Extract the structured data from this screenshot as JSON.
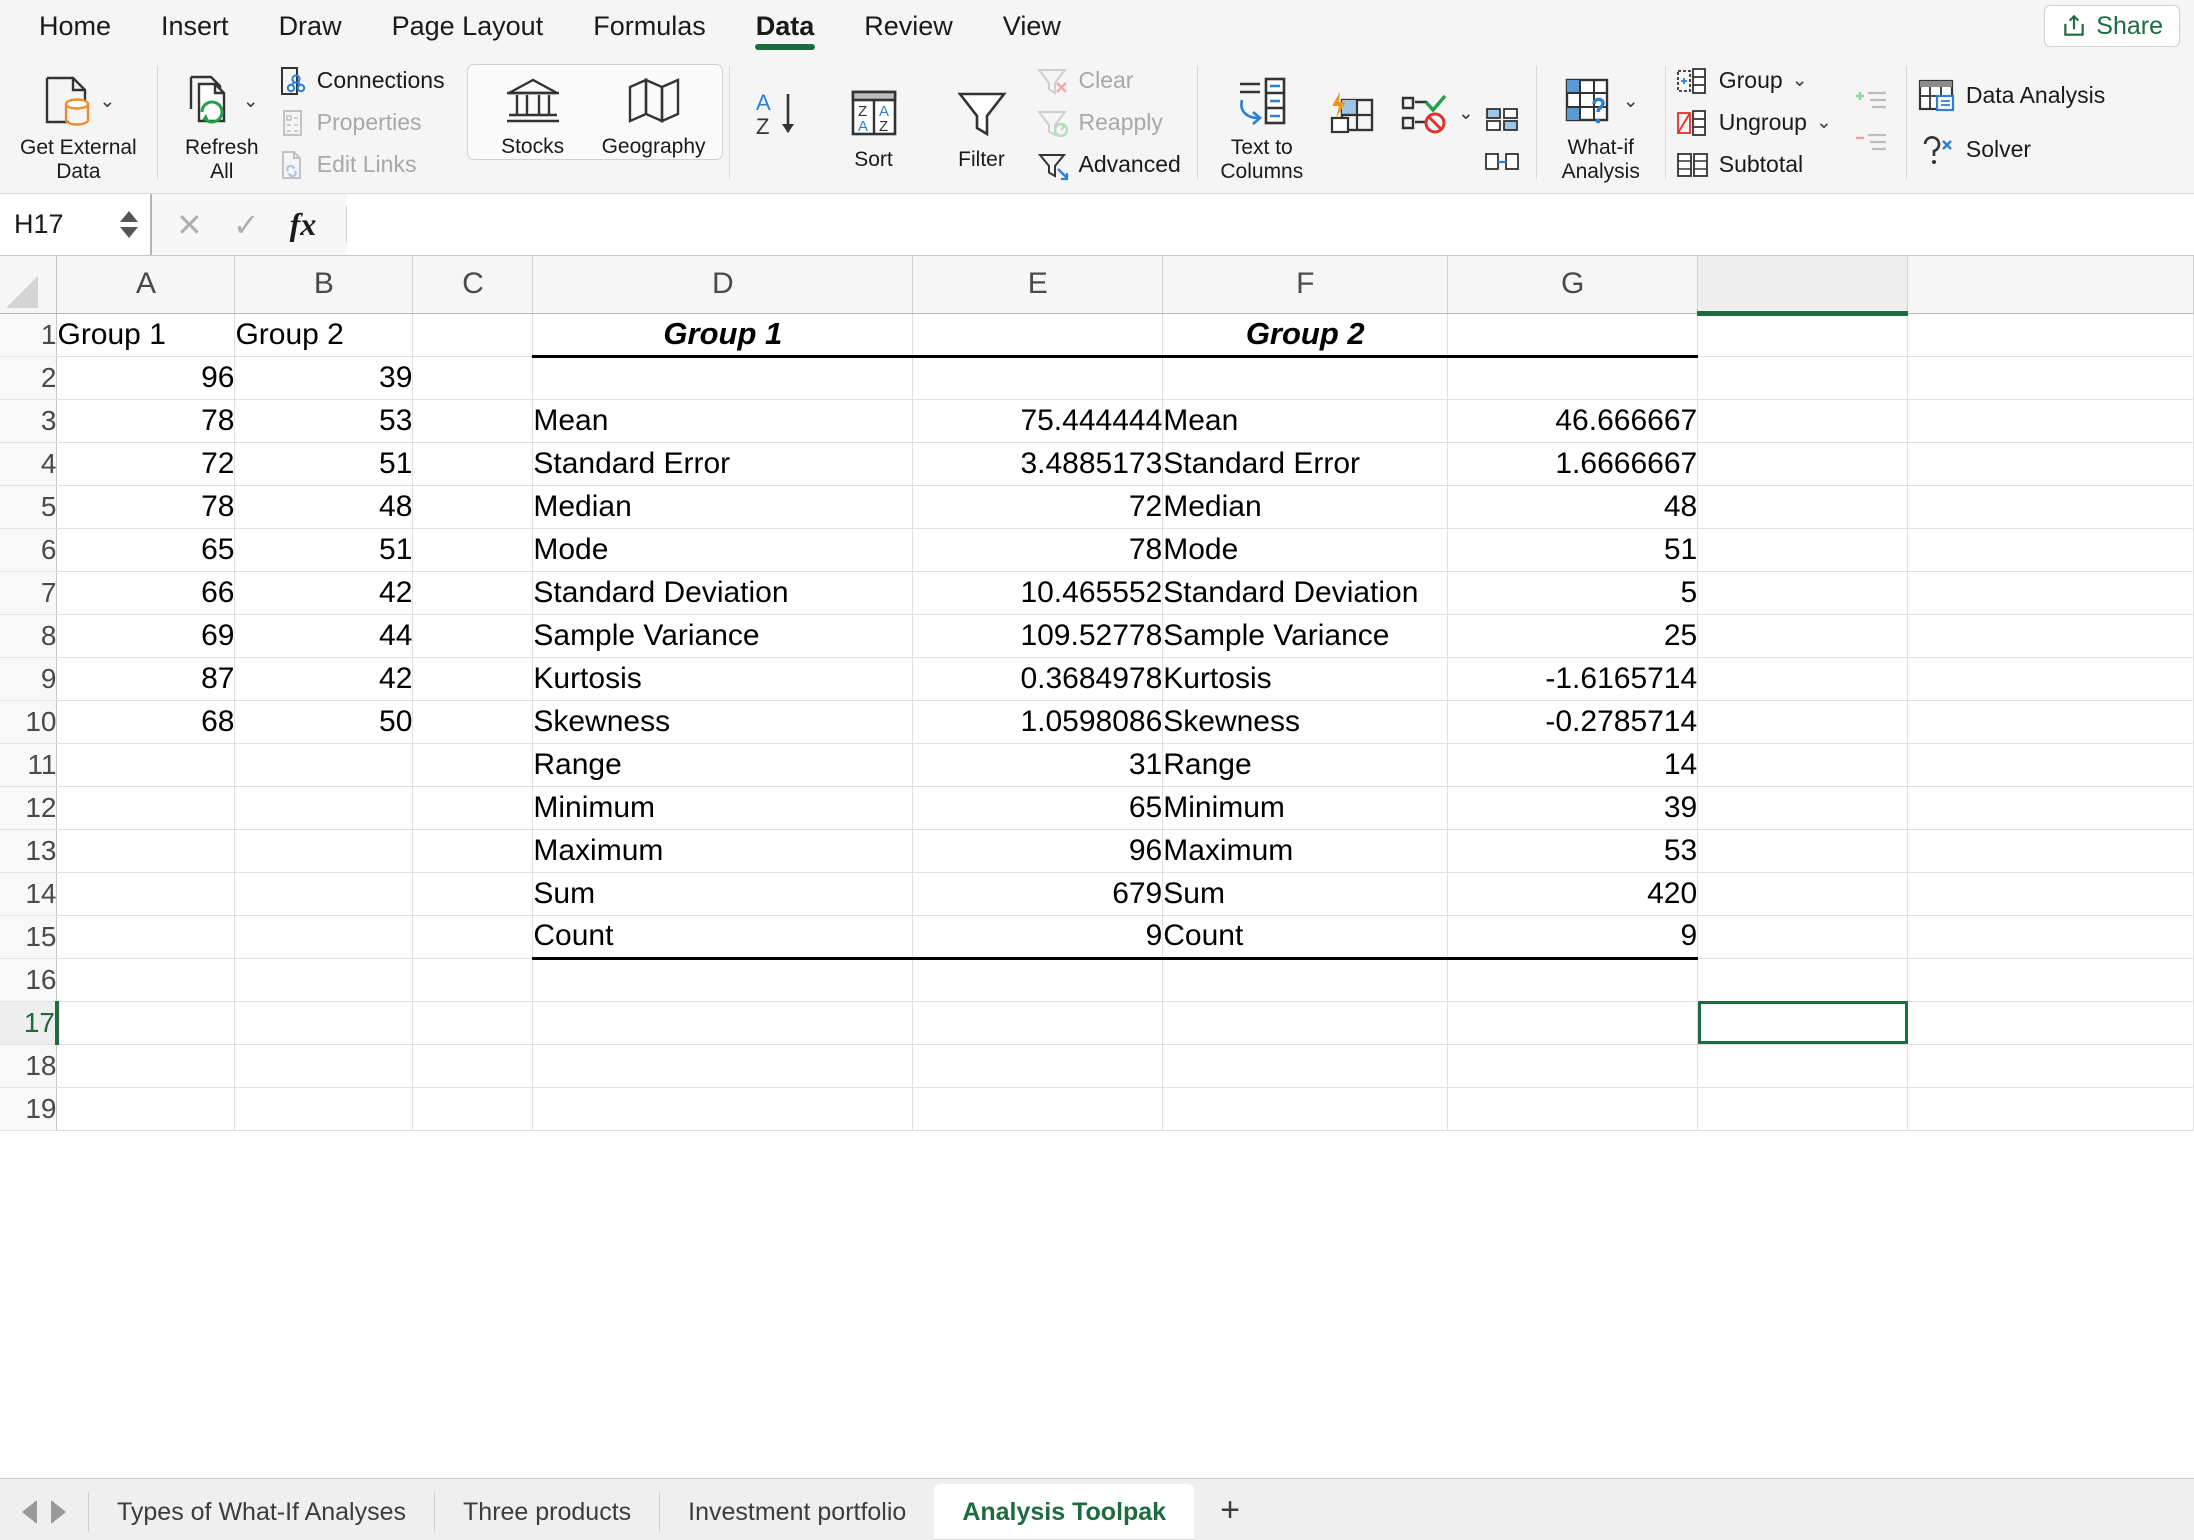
{
  "ribbon_tabs": [
    {
      "label": "Home",
      "active": false
    },
    {
      "label": "Insert",
      "active": false
    },
    {
      "label": "Draw",
      "active": false
    },
    {
      "label": "Page Layout",
      "active": false
    },
    {
      "label": "Formulas",
      "active": false
    },
    {
      "label": "Data",
      "active": true
    },
    {
      "label": "Review",
      "active": false
    },
    {
      "label": "View",
      "active": false
    }
  ],
  "share": {
    "label": "Share",
    "icon": "share-export-icon",
    "color": "#1e6b3f"
  },
  "ribbon": {
    "get_external_data": {
      "label": "Get External\nData",
      "line1": "Get External",
      "line2": "Data",
      "icon": "database-document-icon"
    },
    "refresh_all": {
      "label": "Refresh All",
      "line1": "Refresh",
      "line2": "All",
      "icon": "refresh-documents-icon"
    },
    "connections": {
      "label": "Connections",
      "icon": "connections-icon",
      "disabled": false
    },
    "properties": {
      "label": "Properties",
      "icon": "properties-icon",
      "disabled": true
    },
    "edit_links": {
      "label": "Edit Links",
      "icon": "edit-links-icon",
      "disabled": true
    },
    "stocks": {
      "label": "Stocks",
      "icon": "bank-building-icon"
    },
    "geography": {
      "label": "Geography",
      "icon": "map-icon"
    },
    "sort_az": {
      "label": "",
      "icon": "sort-a-to-z-icon"
    },
    "sort": {
      "label": "Sort",
      "icon": "sort-dialog-icon"
    },
    "filter": {
      "label": "Filter",
      "icon": "funnel-icon"
    },
    "clear": {
      "label": "Clear",
      "icon": "clear-filter-icon",
      "disabled": true
    },
    "reapply": {
      "label": "Reapply",
      "icon": "reapply-filter-icon",
      "disabled": true
    },
    "advanced": {
      "label": "Advanced",
      "icon": "advanced-filter-icon",
      "disabled": false
    },
    "text_to_columns": {
      "label": "Text to Columns",
      "line1": "Text to",
      "line2": "Columns",
      "icon": "text-to-columns-icon"
    },
    "flash_fill": {
      "label": "",
      "icon": "flash-fill-icon"
    },
    "data_validation": {
      "label": "",
      "icon": "data-validation-icon"
    },
    "consolidate": {
      "label": "",
      "icon": "consolidate-icon"
    },
    "relationships": {
      "label": "",
      "icon": "relationships-icon"
    },
    "what_if": {
      "label": "What-if Analysis",
      "line1": "What-if",
      "line2": "Analysis",
      "icon": "what-if-grid-icon"
    },
    "group": {
      "label": "Group",
      "icon": "group-icon"
    },
    "ungroup": {
      "label": "Ungroup",
      "icon": "ungroup-icon"
    },
    "subtotal": {
      "label": "Subtotal",
      "icon": "subtotal-icon"
    },
    "show_detail": {
      "label": "",
      "icon": "show-detail-icon"
    },
    "hide_detail": {
      "label": "",
      "icon": "hide-detail-icon"
    },
    "data_analysis": {
      "label": "Data Analysis",
      "icon": "data-analysis-icon"
    },
    "solver": {
      "label": "Solver",
      "icon": "solver-icon"
    }
  },
  "formula_bar": {
    "name_box_value": "H17",
    "formula_value": "",
    "cancel_icon": "close-icon",
    "confirm_icon": "checkmark-icon",
    "function_icon": "fx-icon"
  },
  "grid": {
    "columns": [
      "A",
      "B",
      "C",
      "D",
      "E",
      "F",
      "G"
    ],
    "selected_column": "H",
    "selected_cell": "H17",
    "selected_row": 17,
    "rows": [
      1,
      2,
      3,
      4,
      5,
      6,
      7,
      8,
      9,
      10,
      11,
      12,
      13,
      14,
      15,
      16,
      17,
      18,
      19
    ],
    "cells": {
      "A1": "Group 1",
      "B1": "Group 2",
      "A2": "96",
      "B2": "39",
      "A3": "78",
      "B3": "53",
      "A4": "72",
      "B4": "51",
      "A5": "78",
      "B5": "48",
      "A6": "65",
      "B6": "51",
      "A7": "66",
      "B7": "42",
      "A8": "69",
      "B8": "44",
      "A9": "87",
      "B9": "42",
      "A10": "68",
      "B10": "50",
      "D1": "Group 1",
      "F1": "Group 2",
      "D3": "Mean",
      "E3": "75.444444",
      "F3": "Mean",
      "G3": "46.666667",
      "D4": "Standard Error",
      "E4": "3.4885173",
      "F4": "Standard Error",
      "G4": "1.6666667",
      "D5": "Median",
      "E5": "72",
      "F5": "Median",
      "G5": "48",
      "D6": "Mode",
      "E6": "78",
      "F6": "Mode",
      "G6": "51",
      "D7": "Standard Deviation",
      "E7": "10.465552",
      "F7": "Standard Deviation",
      "G7": "5",
      "D8": "Sample Variance",
      "E8": "109.52778",
      "F8": "Sample Variance",
      "G8": "25",
      "D9": "Kurtosis",
      "E9": "0.3684978",
      "F9": "Kurtosis",
      "G9": "-1.6165714",
      "D10": "Skewness",
      "E10": "1.0598086",
      "F10": "Skewness",
      "G10": "-0.2785714",
      "D11": "Range",
      "E11": "31",
      "F11": "Range",
      "G11": "14",
      "D12": "Minimum",
      "E12": "65",
      "F12": "Minimum",
      "G12": "39",
      "D13": "Maximum",
      "E13": "96",
      "F13": "Maximum",
      "G13": "53",
      "D14": "Sum",
      "E14": "679",
      "F14": "Sum",
      "G14": "420",
      "D15": "Count",
      "E15": "9",
      "F15": "Count",
      "G15": "9"
    }
  },
  "sheet_tabs": {
    "prev_icon": "prev-sheet-arrow-icon",
    "next_icon": "next-sheet-arrow-icon",
    "add_label": "+",
    "items": [
      {
        "label": "Types of What-If Analyses",
        "active": false
      },
      {
        "label": "Three products",
        "active": false
      },
      {
        "label": "Investment portfolio",
        "active": false
      },
      {
        "label": "Analysis Toolpak",
        "active": true
      }
    ]
  },
  "colors": {
    "accent_green": "#1e6b3f",
    "ribbon_bg": "#f5f5f5",
    "grid_line": "#e0e0e0",
    "header_bg": "#f6f6f6"
  }
}
